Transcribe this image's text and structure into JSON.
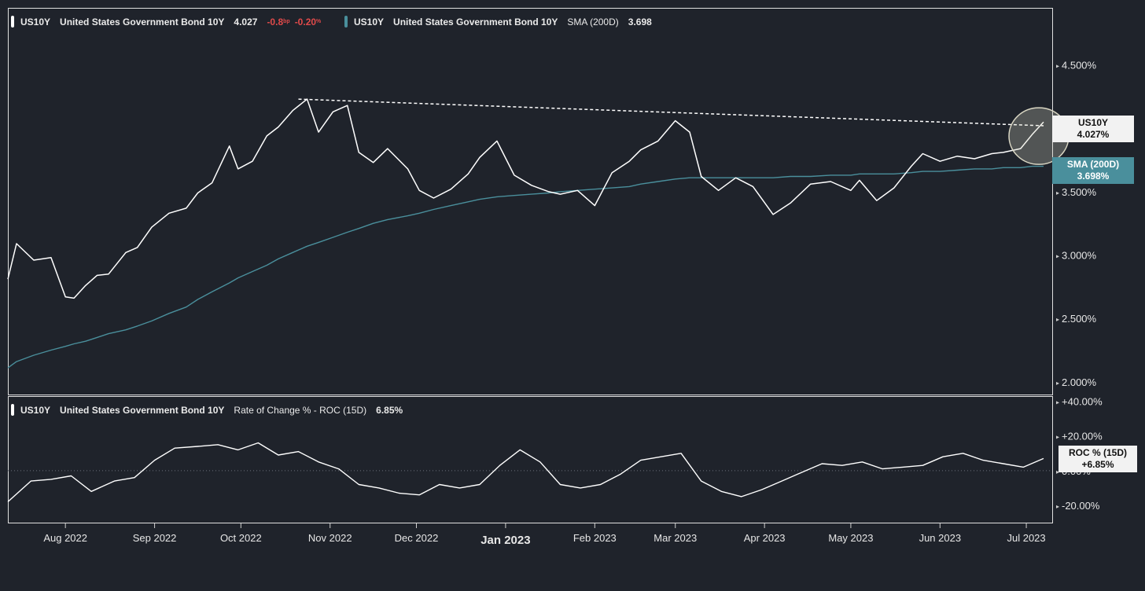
{
  "legend_top": {
    "series_a": {
      "symbol": "US10Y",
      "name": "United States Government Bond 10Y",
      "last": "4.027",
      "chg": "-0.8",
      "chg_unit": "bp",
      "chg_pct": "-0.20",
      "pct_unit": "%"
    },
    "series_b": {
      "symbol": "US10Y",
      "name": "United States Government Bond 10Y",
      "indicator": "SMA (200D)",
      "value": "3.698"
    }
  },
  "legend_bottom": {
    "symbol": "US10Y",
    "name": "United States Government Bond 10Y",
    "indicator": "Rate of Change % - ROC (15D)",
    "value": "6.85%"
  },
  "badges": {
    "price": {
      "line1": "US10Y",
      "line2": "4.027%"
    },
    "sma": {
      "line1": "SMA (200D)",
      "line2": "3.698%"
    },
    "roc": {
      "line1": "ROC % (15D)",
      "line2": "+6.85%"
    }
  },
  "colors": {
    "background": "#1f232b",
    "price": "#ffffff",
    "sma": "#4a8f9c",
    "negative": "#e04a4a",
    "highlight_circle": "#d9d6c3"
  },
  "chart_data": [
    {
      "type": "line",
      "title": "",
      "x_ticks": [
        "Aug 2022",
        "Sep 2022",
        "Oct 2022",
        "Nov 2022",
        "Dec 2022",
        "Jan 2023",
        "Feb 2023",
        "Mar 2023",
        "Apr 2023",
        "May 2023",
        "Jun 2023",
        "Jul 2023"
      ],
      "y_ticks": [
        "4.500%",
        "4.000%",
        "3.500%",
        "3.000%",
        "2.500%",
        "2.000%"
      ],
      "ylim": [
        1.9,
        4.95
      ],
      "x": [
        "2022-07-12",
        "2022-07-15",
        "2022-07-21",
        "2022-07-27",
        "2022-08-01",
        "2022-08-04",
        "2022-08-08",
        "2022-08-12",
        "2022-08-16",
        "2022-08-22",
        "2022-08-26",
        "2022-08-31",
        "2022-09-06",
        "2022-09-12",
        "2022-09-16",
        "2022-09-21",
        "2022-09-27",
        "2022-09-30",
        "2022-10-05",
        "2022-10-10",
        "2022-10-14",
        "2022-10-19",
        "2022-10-24",
        "2022-10-28",
        "2022-11-02",
        "2022-11-07",
        "2022-11-11",
        "2022-11-16",
        "2022-11-21",
        "2022-11-28",
        "2022-12-02",
        "2022-12-07",
        "2022-12-13",
        "2022-12-19",
        "2022-12-23",
        "2022-12-29",
        "2023-01-04",
        "2023-01-10",
        "2023-01-16",
        "2023-01-20",
        "2023-01-26",
        "2023-02-01",
        "2023-02-07",
        "2023-02-13",
        "2023-02-17",
        "2023-02-23",
        "2023-03-01",
        "2023-03-06",
        "2023-03-10",
        "2023-03-16",
        "2023-03-22",
        "2023-03-28",
        "2023-04-04",
        "2023-04-10",
        "2023-04-17",
        "2023-04-24",
        "2023-05-01",
        "2023-05-04",
        "2023-05-10",
        "2023-05-16",
        "2023-05-22",
        "2023-05-26",
        "2023-06-01",
        "2023-06-07",
        "2023-06-13",
        "2023-06-19",
        "2023-06-23",
        "2023-06-29",
        "2023-07-03",
        "2023-07-07"
      ],
      "series": [
        {
          "name": "United States Government Bond 10Y",
          "values": [
            2.81,
            3.09,
            2.96,
            2.98,
            2.67,
            2.66,
            2.76,
            2.84,
            2.85,
            3.02,
            3.06,
            3.22,
            3.33,
            3.37,
            3.49,
            3.57,
            3.86,
            3.68,
            3.74,
            3.94,
            4.01,
            4.14,
            4.23,
            3.97,
            4.13,
            4.18,
            3.81,
            3.73,
            3.84,
            3.68,
            3.51,
            3.45,
            3.52,
            3.64,
            3.77,
            3.9,
            3.63,
            3.55,
            3.5,
            3.48,
            3.51,
            3.39,
            3.65,
            3.74,
            3.83,
            3.9,
            4.06,
            3.97,
            3.62,
            3.51,
            3.61,
            3.54,
            3.32,
            3.41,
            3.56,
            3.58,
            3.51,
            3.59,
            3.43,
            3.53,
            3.7,
            3.8,
            3.74,
            3.78,
            3.76,
            3.8,
            3.81,
            3.84,
            3.95,
            4.05
          ]
        },
        {
          "name": "SMA (200D)",
          "values": [
            2.11,
            2.16,
            2.21,
            2.25,
            2.28,
            2.3,
            2.32,
            2.35,
            2.38,
            2.41,
            2.44,
            2.48,
            2.54,
            2.59,
            2.65,
            2.71,
            2.78,
            2.82,
            2.87,
            2.92,
            2.97,
            3.02,
            3.07,
            3.1,
            3.14,
            3.18,
            3.21,
            3.25,
            3.28,
            3.31,
            3.33,
            3.36,
            3.39,
            3.42,
            3.44,
            3.46,
            3.47,
            3.48,
            3.49,
            3.5,
            3.51,
            3.52,
            3.53,
            3.54,
            3.56,
            3.58,
            3.6,
            3.61,
            3.61,
            3.61,
            3.61,
            3.61,
            3.61,
            3.62,
            3.62,
            3.63,
            3.63,
            3.64,
            3.64,
            3.64,
            3.65,
            3.66,
            3.66,
            3.67,
            3.68,
            3.68,
            3.69,
            3.69,
            3.7,
            3.7
          ]
        }
      ],
      "trendline": {
        "x": [
          "2022-10-21",
          "2023-07-07"
        ],
        "values": [
          4.23,
          4.02
        ]
      }
    },
    {
      "type": "line",
      "title": "",
      "y_ticks": [
        "+40.00%",
        "+20.00%",
        "0.00%",
        "-20.00%"
      ],
      "ylim": [
        -30,
        43
      ],
      "x": [
        "2022-07-12",
        "2022-07-20",
        "2022-07-27",
        "2022-08-03",
        "2022-08-10",
        "2022-08-18",
        "2022-08-25",
        "2022-09-01",
        "2022-09-08",
        "2022-09-16",
        "2022-09-23",
        "2022-09-30",
        "2022-10-07",
        "2022-10-14",
        "2022-10-21",
        "2022-10-28",
        "2022-11-04",
        "2022-11-11",
        "2022-11-18",
        "2022-11-25",
        "2022-12-02",
        "2022-12-09",
        "2022-12-16",
        "2022-12-23",
        "2022-12-30",
        "2023-01-06",
        "2023-01-13",
        "2023-01-20",
        "2023-01-27",
        "2023-02-03",
        "2023-02-10",
        "2023-02-17",
        "2023-02-24",
        "2023-03-03",
        "2023-03-10",
        "2023-03-17",
        "2023-03-24",
        "2023-03-31",
        "2023-04-07",
        "2023-04-14",
        "2023-04-21",
        "2023-04-28",
        "2023-05-05",
        "2023-05-12",
        "2023-05-19",
        "2023-05-26",
        "2023-06-02",
        "2023-06-09",
        "2023-06-16",
        "2023-06-23",
        "2023-06-30",
        "2023-07-07"
      ],
      "series": [
        {
          "name": "Rate of Change % - ROC (15D)",
          "values": [
            -18,
            -6,
            -5,
            -3,
            -12,
            -6,
            -4,
            6,
            13,
            14,
            15,
            12,
            16,
            9,
            11,
            5,
            1,
            -8,
            -10,
            -13,
            -14,
            -8,
            -10,
            -8,
            3,
            12,
            5,
            -8,
            -10,
            -8,
            -2,
            6,
            8,
            10,
            -6,
            -12,
            -15,
            -11,
            -6,
            -1,
            4,
            3,
            5,
            1,
            2,
            3,
            8,
            10,
            6,
            4,
            2,
            7
          ]
        }
      ]
    }
  ]
}
